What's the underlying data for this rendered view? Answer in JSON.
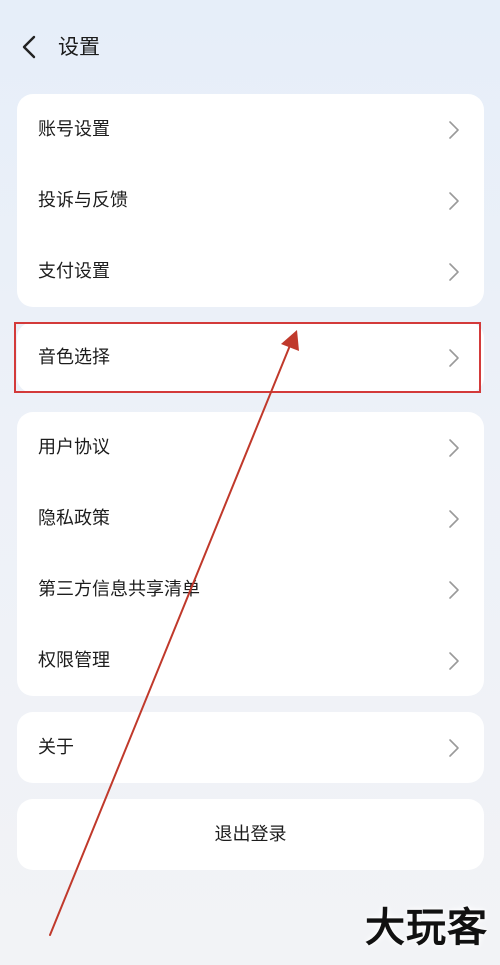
{
  "header": {
    "title": "设置",
    "back_icon": "chevron-left-icon"
  },
  "groups": {
    "account": [
      {
        "label": "账号设置"
      },
      {
        "label": "投诉与反馈"
      },
      {
        "label": "支付设置"
      }
    ],
    "voice": [
      {
        "label": "音色选择",
        "highlighted": true
      }
    ],
    "legal": [
      {
        "label": "用户协议"
      },
      {
        "label": "隐私政策"
      },
      {
        "label": "第三方信息共享清单"
      },
      {
        "label": "权限管理"
      }
    ],
    "about": [
      {
        "label": "关于"
      }
    ]
  },
  "logout": {
    "label": "退出登录"
  },
  "annotation": {
    "box_color": "#d33a3a",
    "arrow_color": "#c0392b"
  },
  "watermark": {
    "text": "大玩客"
  },
  "colors": {
    "card": "#ffffff",
    "background": "#e9eff8",
    "chevron": "#9a9a9a"
  }
}
